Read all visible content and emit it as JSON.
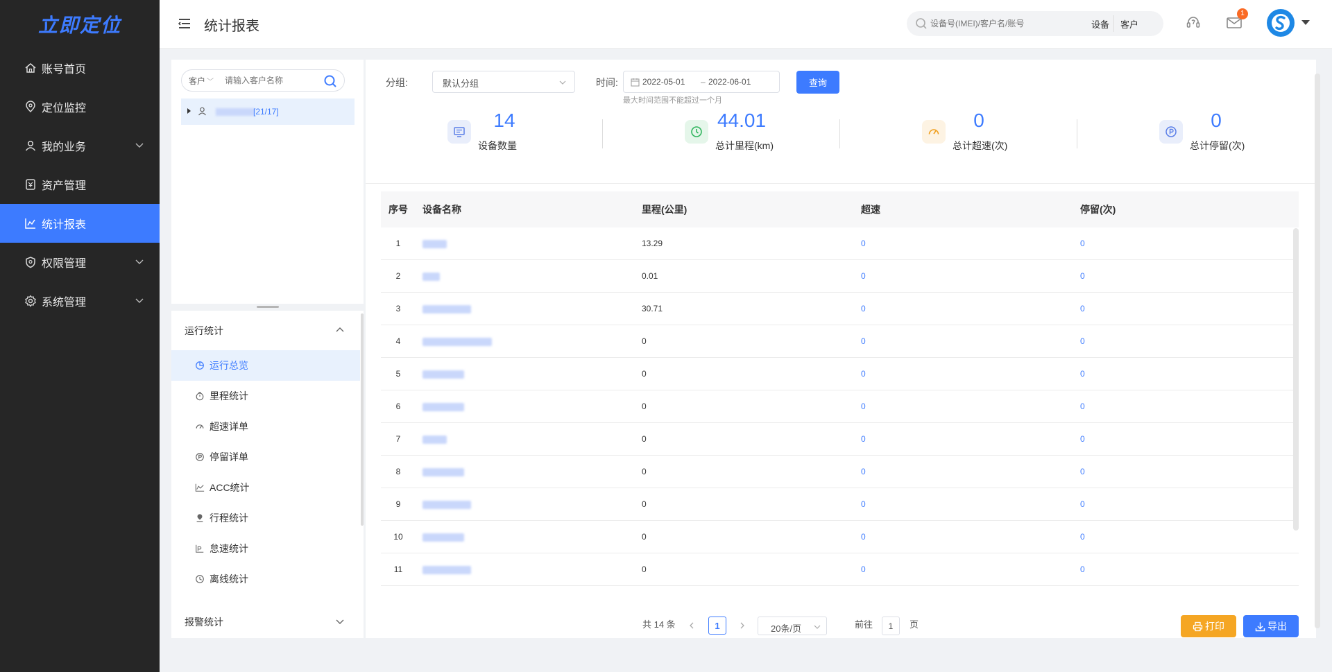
{
  "app": {
    "logo_text": "立即定位"
  },
  "sidebar": {
    "items": [
      {
        "label": "账号首页",
        "icon": "home-icon"
      },
      {
        "label": "定位监控",
        "icon": "location-icon"
      },
      {
        "label": "我的业务",
        "icon": "user-icon",
        "expandable": true
      },
      {
        "label": "资产管理",
        "icon": "asset-icon"
      },
      {
        "label": "统计报表",
        "icon": "chart-icon",
        "active": true
      },
      {
        "label": "权限管理",
        "icon": "shield-icon",
        "expandable": true
      },
      {
        "label": "系统管理",
        "icon": "gear-icon",
        "expandable": true
      }
    ]
  },
  "header": {
    "title": "统计报表",
    "search_placeholder": "设备号(IMEI)/客户名/账号",
    "search_tag_device": "设备",
    "search_tag_customer": "客户",
    "notification_count": "1"
  },
  "left_panel": {
    "customer_select": "客户",
    "customer_placeholder": "请输入客户名称",
    "tree_node_count": "[21/17]",
    "section_run": "运行统计",
    "section_alarm": "报警统计",
    "menu_items": [
      {
        "label": "运行总览",
        "icon": "pie-chart-icon",
        "active": true
      },
      {
        "label": "里程统计",
        "icon": "timer-icon"
      },
      {
        "label": "超速详单",
        "icon": "speedometer-icon"
      },
      {
        "label": "停留详单",
        "icon": "parking-icon"
      },
      {
        "label": "ACC统计",
        "icon": "line-chart-icon"
      },
      {
        "label": "行程统计",
        "icon": "pin-icon"
      },
      {
        "label": "怠速统计",
        "icon": "idle-icon"
      },
      {
        "label": "离线统计",
        "icon": "clock-icon"
      }
    ]
  },
  "filters": {
    "group_label": "分组:",
    "group_value": "默认分组",
    "time_label": "时间:",
    "date_start": "2022-05-01",
    "date_sep": "–",
    "date_end": "2022-06-01",
    "hint": "最大时间范围不能超过一个月",
    "query_button": "查询"
  },
  "stats": [
    {
      "value": "14",
      "label": "设备数量",
      "icon": "monitor-icon",
      "color": "#5b7fe8",
      "bg": "#e9eefb"
    },
    {
      "value": "44.01",
      "label": "总计里程(km)",
      "icon": "clock-green-icon",
      "color": "#2fb55d",
      "bg": "#e5f6ea"
    },
    {
      "value": "0",
      "label": "总计超速(次)",
      "icon": "gauge-icon",
      "color": "#f0a020",
      "bg": "#fdf3e3"
    },
    {
      "value": "0",
      "label": "总计停留(次)",
      "icon": "parking-circle-icon",
      "color": "#5b7fe8",
      "bg": "#e9eefb"
    }
  ],
  "table": {
    "headers": [
      "序号",
      "设备名称",
      "里程(公里)",
      "超速",
      "停留(次)"
    ],
    "rows": [
      {
        "idx": "1",
        "mileage": "13.29",
        "overspeed": "0",
        "stay": "0",
        "name_blur": 0.35
      },
      {
        "idx": "2",
        "mileage": "0.01",
        "overspeed": "0",
        "stay": "0",
        "name_blur": 0.25
      },
      {
        "idx": "3",
        "mileage": "30.71",
        "overspeed": "0",
        "stay": "0",
        "name_blur": 0.7
      },
      {
        "idx": "4",
        "mileage": "0",
        "overspeed": "0",
        "stay": "0",
        "name_blur": 1.0
      },
      {
        "idx": "5",
        "mileage": "0",
        "overspeed": "0",
        "stay": "0",
        "name_blur": 0.6
      },
      {
        "idx": "6",
        "mileage": "0",
        "overspeed": "0",
        "stay": "0",
        "name_blur": 0.6
      },
      {
        "idx": "7",
        "mileage": "0",
        "overspeed": "0",
        "stay": "0",
        "name_blur": 0.35
      },
      {
        "idx": "8",
        "mileage": "0",
        "overspeed": "0",
        "stay": "0",
        "name_blur": 0.6
      },
      {
        "idx": "9",
        "mileage": "0",
        "overspeed": "0",
        "stay": "0",
        "name_blur": 0.7
      },
      {
        "idx": "10",
        "mileage": "0",
        "overspeed": "0",
        "stay": "0",
        "name_blur": 0.6
      },
      {
        "idx": "11",
        "mileage": "0",
        "overspeed": "0",
        "stay": "0",
        "name_blur": 0.7
      }
    ]
  },
  "pagination": {
    "total_text": "共 14 条",
    "current_page": "1",
    "page_size": "20条/页",
    "goto_label": "前往",
    "goto_value": "1",
    "page_suffix": "页"
  },
  "actions": {
    "print": "打印",
    "export": "导出"
  },
  "colors": {
    "accent": "#3d7bff",
    "sidebar_bg": "#262626",
    "print": "#f5a623"
  }
}
